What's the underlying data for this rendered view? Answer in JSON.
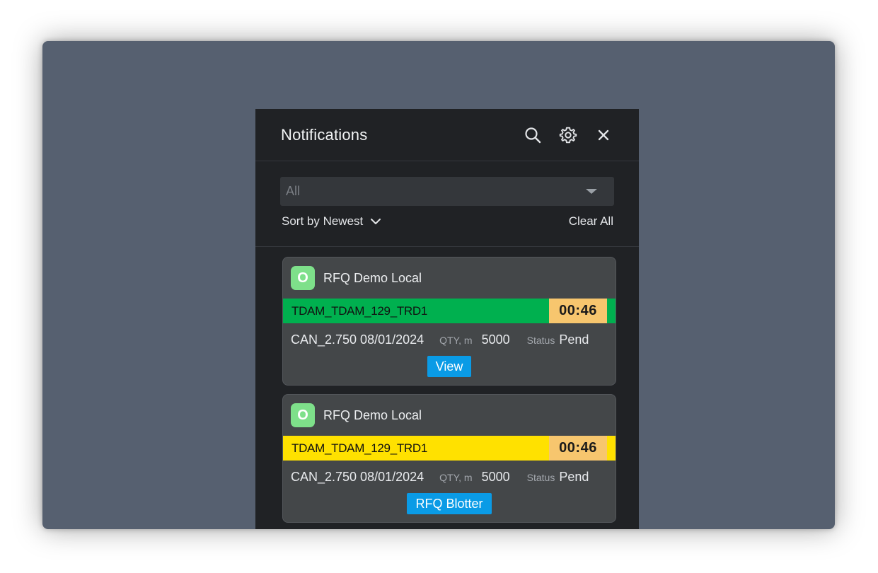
{
  "panel": {
    "title": "Notifications",
    "icons": [
      "search-icon",
      "gear-icon",
      "close-icon"
    ]
  },
  "filter": {
    "value": "All",
    "sort_label": "Sort by Newest",
    "clear_label": "Clear All"
  },
  "notifications": [
    {
      "badge": "O",
      "app": "RFQ Demo Local",
      "trade_id": "TDAM_TDAM_129_TRD1",
      "bar_color": "#00b04f",
      "timer": "00:46",
      "instrument": "CAN_2.750 08/01/2024",
      "qty_label": "QTY, m",
      "qty": "5000",
      "status_label": "Status",
      "status": "Pend",
      "action": "View"
    },
    {
      "badge": "O",
      "app": "RFQ Demo Local",
      "trade_id": "TDAM_TDAM_129_TRD1",
      "bar_color": "#ffe100",
      "timer": "00:46",
      "instrument": "CAN_2.750 08/01/2024",
      "qty_label": "QTY, m",
      "qty": "5000",
      "status_label": "Status",
      "status": "Pend",
      "action": "RFQ Blotter"
    }
  ],
  "colors": {
    "backdrop": "#566070",
    "panel": "#202225",
    "card": "#444749",
    "accent": "#0a9be6",
    "timer": "#f7c66e",
    "badge": "#7ee08a"
  }
}
